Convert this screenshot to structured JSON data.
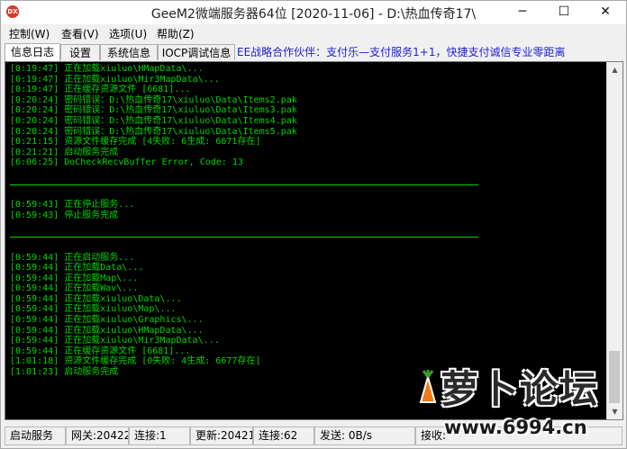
{
  "window": {
    "title": "GeeM2微端服务器64位 [2020-11-06] - D:\\热血传奇17\\",
    "icon_label": "DX",
    "min_glyph": "─",
    "max_glyph": "☐",
    "close_glyph": "✕"
  },
  "menu": [
    "控制(W)",
    "查看(V)",
    "选项(U)",
    "帮助(Z)"
  ],
  "tabs": [
    "信息日志",
    "设置",
    "系统信息",
    "IOCP调试信息"
  ],
  "active_tab": 0,
  "marquee_text": "EE战略合作伙伴：支付乐—支付服务1+1，快捷支付诚信专业零距离",
  "log_lines": [
    "[0:19:47] 正在加载xiuluo\\HMapData\\...",
    "[0:19:47] 正在加载xiuluo\\Mir3MapData\\...",
    "[0:19:47] 正在缓存资源文件 [6681]...",
    "[0:20:24] 密码错误：D:\\热血传奇17\\xiuluo\\Data\\Items2.pak",
    "[0:20:24] 密码错误：D:\\热血传奇17\\xiuluo\\Data\\Items3.pak",
    "[0:20:24] 密码错误：D:\\热血传奇17\\xiuluo\\Data\\Items4.pak",
    "[0:20:24] 密码错误：D:\\热血传奇17\\xiuluo\\Data\\Items5.pak",
    "[0:21:15] 资源文件缓存完成 [4失败: 6生成: 6671存在]",
    "[0:21:21] 启动服务完成",
    "[6:06:25] DoCheckRecvBuffer Error, Code: 13",
    "",
    "---",
    "",
    "[0:59:43] 正在停止服务...",
    "[0:59:43] 停止服务完成",
    "",
    "---",
    "",
    "[0:59:44] 正在启动服务...",
    "[0:59:44] 正在加载Data\\...",
    "[0:59:44] 正在加载Map\\...",
    "[0:59:44] 正在加载Wav\\...",
    "[0:59:44] 正在加载xiuluo\\Data\\...",
    "[0:59:44] 正在加载xiuluo\\Map\\...",
    "[0:59:44] 正在加载xiuluo\\Graphics\\...",
    "[0:59:44] 正在加载xiuluo\\HMapData\\...",
    "[0:59:44] 正在加载xiuluo\\Mir3MapData\\...",
    "[0:59:44] 正在缓存资源文件 [6681]...",
    "[1:01:18] 资源文件缓存完成 [0失败: 4生成: 6677存在]",
    "[1:01:23] 启动服务完成"
  ],
  "status": {
    "start_service": "启动服务",
    "gateway": "网关:20422",
    "connections1": "连接:1",
    "update": "更新:20421",
    "connections2": "连接:62",
    "send": "发送: 0B/s",
    "receive": "接收:"
  },
  "watermark": {
    "text": "萝卜论坛",
    "url": "www.6994.cn"
  },
  "colors": {
    "log_text": "#00d800",
    "log_background": "#000000",
    "marquee": "#1f1fd1"
  }
}
